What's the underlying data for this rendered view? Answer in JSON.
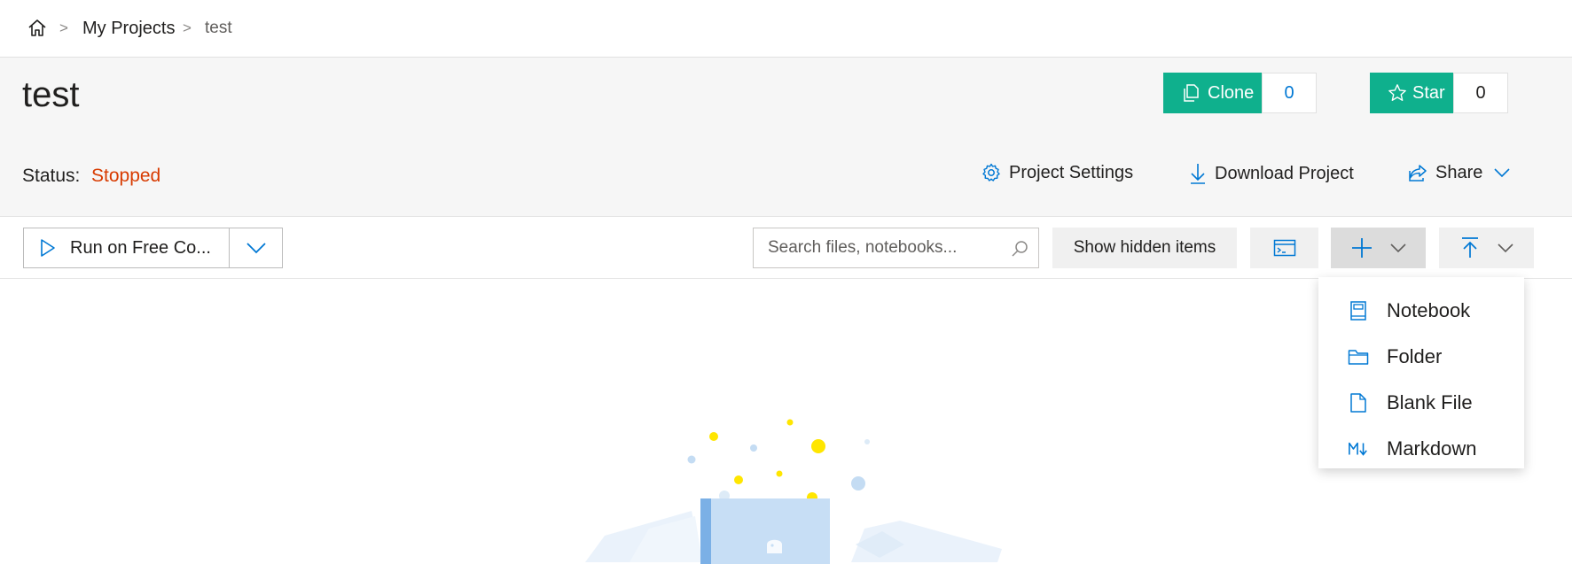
{
  "breadcrumb": {
    "separator": ">",
    "items": [
      "My Projects"
    ],
    "current": "test"
  },
  "project": {
    "title": "test",
    "status_label": "Status:",
    "status_value": "Stopped"
  },
  "header_buttons": {
    "clone_label": "Clone",
    "clone_count": "0",
    "star_label": "Star",
    "star_count": "0"
  },
  "actions": {
    "settings": "Project Settings",
    "download": "Download Project",
    "share": "Share"
  },
  "toolbar": {
    "run_label": "Run on Free Co...",
    "search_placeholder": "Search files, notebooks...",
    "show_hidden": "Show hidden items"
  },
  "new_menu": {
    "items": [
      {
        "label": "Notebook",
        "icon": "notebook-icon"
      },
      {
        "label": "Folder",
        "icon": "folder-icon"
      },
      {
        "label": "Blank File",
        "icon": "blank-file-icon"
      },
      {
        "label": "Markdown",
        "icon": "markdown-icon"
      }
    ]
  },
  "colors": {
    "accent_green": "#0fb08d",
    "status_red": "#d83b01",
    "icon_blue": "#0078d4"
  }
}
